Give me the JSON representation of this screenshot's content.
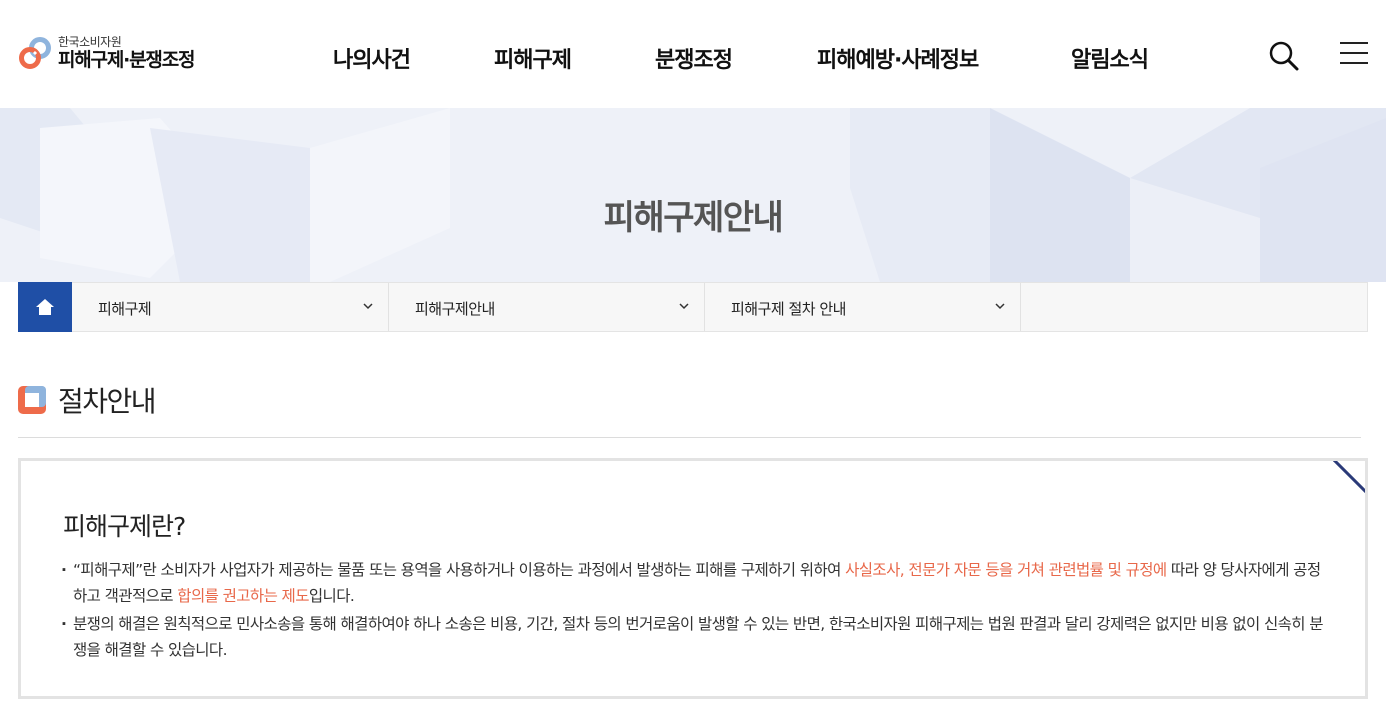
{
  "header": {
    "logo_small": "한국소비자원",
    "logo_big": "피해구제·분쟁조정",
    "nav": [
      {
        "label": "나의사건"
      },
      {
        "label": "피해구제"
      },
      {
        "label": "분쟁조정"
      },
      {
        "label": "피해예방·사례정보"
      },
      {
        "label": "알림소식"
      }
    ]
  },
  "visual": {
    "title": "피해구제안내"
  },
  "breadcrumb": {
    "items": [
      {
        "label": "피해구제"
      },
      {
        "label": "피해구제안내"
      },
      {
        "label": "피해구제 절차 안내"
      }
    ]
  },
  "section": {
    "title": "절차안내"
  },
  "infobox": {
    "title": "피해구제란?",
    "p1_a": "“피해구제”란 소비자가 사업자가 제공하는 물품 또는 용역을 사용하거나 이용하는 과정에서 발생하는 피해를 구제하기 위하여 ",
    "p1_hl1": "사실조사, 전문가 자문 등을 거쳐 관련법률 및 규정에",
    "p1_b": " 따라 양 당사자에게 공정하고 객관적으로 ",
    "p1_hl2": "합의를 권고하는 제도",
    "p1_c": "입니다.",
    "p2": "분쟁의 해결은 원칙적으로 민사소송을 통해 해결하여야 하나 소송은 비용, 기간, 절차 등의 번거로움이 발생할 수 있는 반면, 한국소비자원 피해구제는 법원 판결과 달리 강제력은 없지만 비용 없이 신속히 분쟁을 해결할 수 있습니다."
  },
  "colors": {
    "accent_blue": "#1f4fa6",
    "highlight_orange": "#e8684a",
    "logo_orange": "#ee6b4a",
    "logo_blue": "#8fb4dd"
  }
}
